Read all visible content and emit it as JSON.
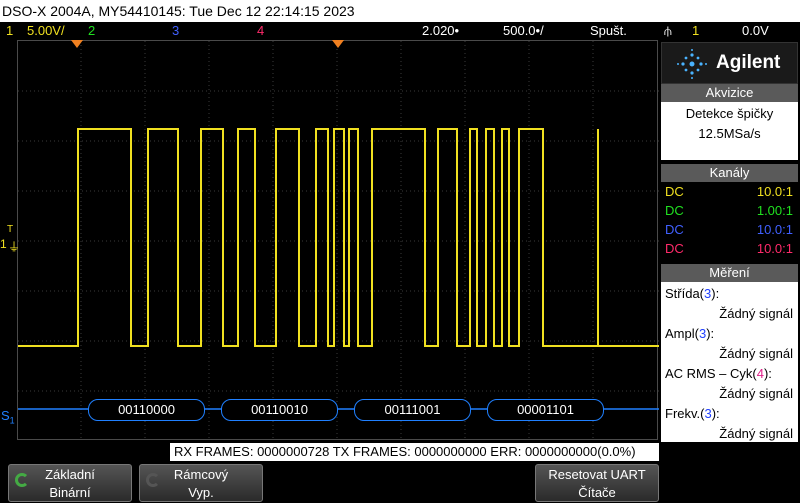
{
  "title": "DSO-X 2004A, MY54410145: Tue Dec 12 22:14:15 2023",
  "status": {
    "ch1_num": "1",
    "ch1_scale": "5.00V/",
    "ch2_num": "2",
    "ch3_num": "3",
    "ch4_num": "4",
    "time_offset": "2.020•",
    "time_scale": "500.0•/",
    "trigger_mode": "Spušt.",
    "trigger_channel": "1",
    "trigger_level": "0.0V"
  },
  "colors": {
    "ch1": "#f0e020",
    "ch2": "#20e020",
    "ch3": "#4060ff",
    "ch4": "#ff2a6a",
    "decode": "#2080ff"
  },
  "logo": {
    "brand": "Agilent"
  },
  "acquisition": {
    "header": "Akvizice",
    "mode": "Detekce špičky",
    "rate": "12.5MSa/s"
  },
  "channels": {
    "header": "Kanály",
    "rows": [
      {
        "coupling": "DC",
        "probe": "10.0:1"
      },
      {
        "coupling": "DC",
        "probe": "1.00:1"
      },
      {
        "coupling": "DC",
        "probe": "10.0:1"
      },
      {
        "coupling": "DC",
        "probe": "10.0:1"
      }
    ]
  },
  "measurements": {
    "header": "Měření",
    "items": [
      {
        "name": "Střída(",
        "ch": "3",
        "close": "):",
        "value": "Žádný signál"
      },
      {
        "name": "Ampl(",
        "ch": "3",
        "close": "):",
        "value": "Žádný signál"
      },
      {
        "name": "AC RMS – Cyk(",
        "ch": "4",
        "close": "):",
        "value": "Žádný signál"
      },
      {
        "name": "Frekv.(",
        "ch": "3",
        "close": "):",
        "value": "Žádný signál"
      }
    ]
  },
  "decode": {
    "label": "S",
    "sub": "1",
    "bytes": [
      "00110000",
      "00110010",
      "00111001",
      "00001101"
    ]
  },
  "markers": {
    "ground": "1",
    "trigger": "T"
  },
  "info": "RX FRAMES: 0000000728  TX FRAMES: 0000000000  ERR: 0000000000(0.0%)",
  "softkeys": [
    {
      "line1": "Základní",
      "line2": "Binární",
      "icon": "circular-arrow-icon"
    },
    {
      "line1": "Rámcový",
      "line2": "Vyp.",
      "icon": "circular-arrow-icon"
    },
    {
      "line1": "Resetovat UART",
      "line2": "Čítače",
      "icon": ""
    }
  ]
}
